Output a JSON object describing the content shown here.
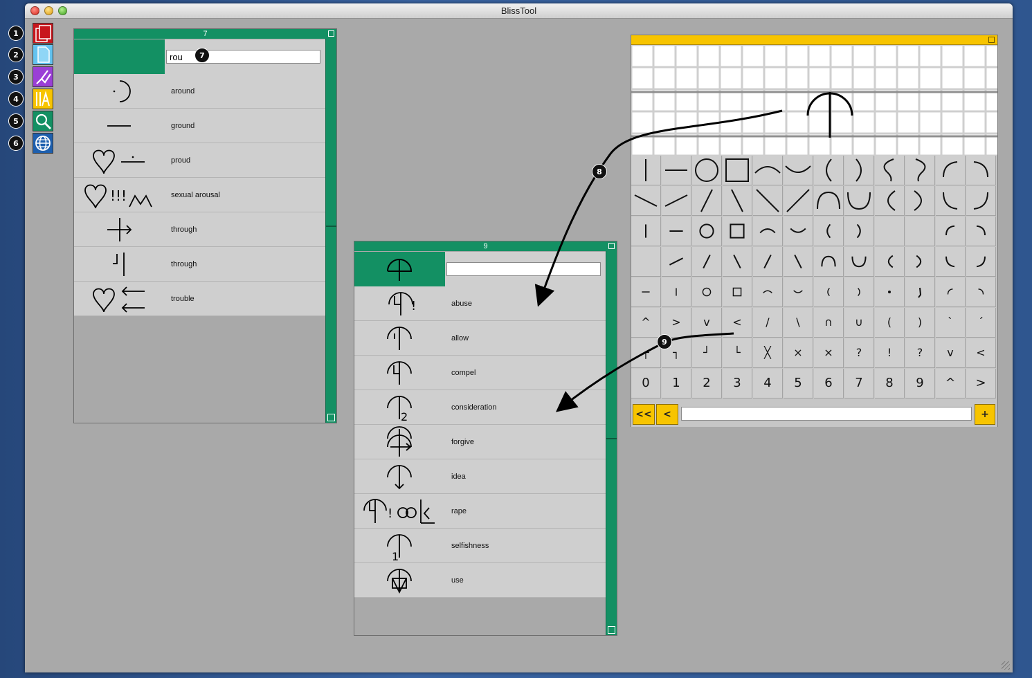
{
  "window": {
    "title": "BlissTool"
  },
  "toolbar": {
    "buttons": [
      {
        "name": "lexicon-book",
        "icon": "books-icon",
        "callout": "1",
        "color": "#c8161d"
      },
      {
        "name": "new-document",
        "icon": "document-icon",
        "callout": "2",
        "color": "#64c3f0"
      },
      {
        "name": "drawing-tool",
        "icon": "pen-icon",
        "callout": "3",
        "color": "#9a3fd6"
      },
      {
        "name": "composer-tool",
        "icon": "compose-icon",
        "callout": "4",
        "color": "#f7c400"
      },
      {
        "name": "search-tool",
        "icon": "magnifier-icon",
        "callout": "5",
        "color": "#139063"
      },
      {
        "name": "globe-tool",
        "icon": "globe-icon",
        "callout": "6",
        "color": "#1d5fae"
      }
    ]
  },
  "left_panel": {
    "title": "7",
    "search_value": "rou",
    "callout": "7",
    "rows": [
      {
        "label": "around",
        "symbol": "around"
      },
      {
        "label": "ground",
        "symbol": "ground"
      },
      {
        "label": "proud",
        "symbol": "proud"
      },
      {
        "label": "sexual arousal",
        "symbol": "arousal"
      },
      {
        "label": "through",
        "symbol": "through1"
      },
      {
        "label": "through",
        "symbol": "through2"
      },
      {
        "label": "trouble",
        "symbol": "trouble"
      }
    ]
  },
  "middle_panel": {
    "title": "9",
    "search_value": "",
    "rows": [
      {
        "label": "abuse",
        "symbol": "abuse"
      },
      {
        "label": "allow",
        "symbol": "allow"
      },
      {
        "label": "compel",
        "symbol": "compel"
      },
      {
        "label": "consideration",
        "symbol": "consideration"
      },
      {
        "label": "forgive",
        "symbol": "forgive"
      },
      {
        "label": "idea",
        "symbol": "idea"
      },
      {
        "label": "rape",
        "symbol": "rape"
      },
      {
        "label": "selfishness",
        "symbol": "selfishness"
      },
      {
        "label": "use",
        "symbol": "use"
      }
    ]
  },
  "composer": {
    "accent": "#f7c400",
    "callouts": [
      "8",
      "9"
    ],
    "shape_rows": [
      [
        "vline",
        "hline",
        "circle",
        "square",
        "arc-top",
        "arc-bottom",
        "paren-l",
        "paren-r",
        "hook-l",
        "hook-r",
        "corner-arc-l",
        "corner-arc-r"
      ],
      [
        "diag-down-l",
        "diag-up",
        "slash",
        "backslash",
        "diag-big-down",
        "diag-big-up",
        "arch",
        "cup",
        "paren-bl",
        "paren-br",
        "quarter-bl",
        "quarter-br"
      ],
      [
        "vline-m",
        "hline-m",
        "circle-m",
        "square-m",
        "arc-top-m",
        "arc-bottom-m",
        "paren-l-m",
        "paren-r-m",
        "empty",
        "empty",
        "corner-arc-l-m",
        "corner-arc-r-m"
      ],
      [
        "diag-down-m",
        "diag-up-m",
        "slash-m",
        "backslash-m",
        "slash-m2",
        "backslash-m2",
        "arch-m",
        "cup-m",
        "paren-bl-m",
        "paren-br-m",
        "quarter-bl-m",
        "quarter-br-m"
      ],
      [
        "hline-s",
        "vline-s",
        "circle-s",
        "square-s",
        "arc-top-s",
        "arc-bottom-s",
        "paren-l-s",
        "paren-r-s",
        "dot",
        "comma",
        "corner-arc-l-s",
        "corner-arc-r-s"
      ]
    ],
    "text_rows": [
      [
        "^",
        ">",
        "v",
        "<",
        "/",
        "\\",
        "∩",
        "∪",
        "(",
        ")",
        "`",
        "´"
      ],
      [
        "┌",
        "┐",
        "┘",
        "└",
        "╳",
        "×",
        "×",
        "?",
        "!",
        "?",
        "v",
        "<"
      ],
      [
        "0",
        "1",
        "2",
        "3",
        "4",
        "5",
        "6",
        "7",
        "8",
        "9",
        "^",
        ">"
      ]
    ],
    "nav": {
      "first": "<<",
      "prev": "<",
      "add": "+"
    },
    "input_value": ""
  }
}
